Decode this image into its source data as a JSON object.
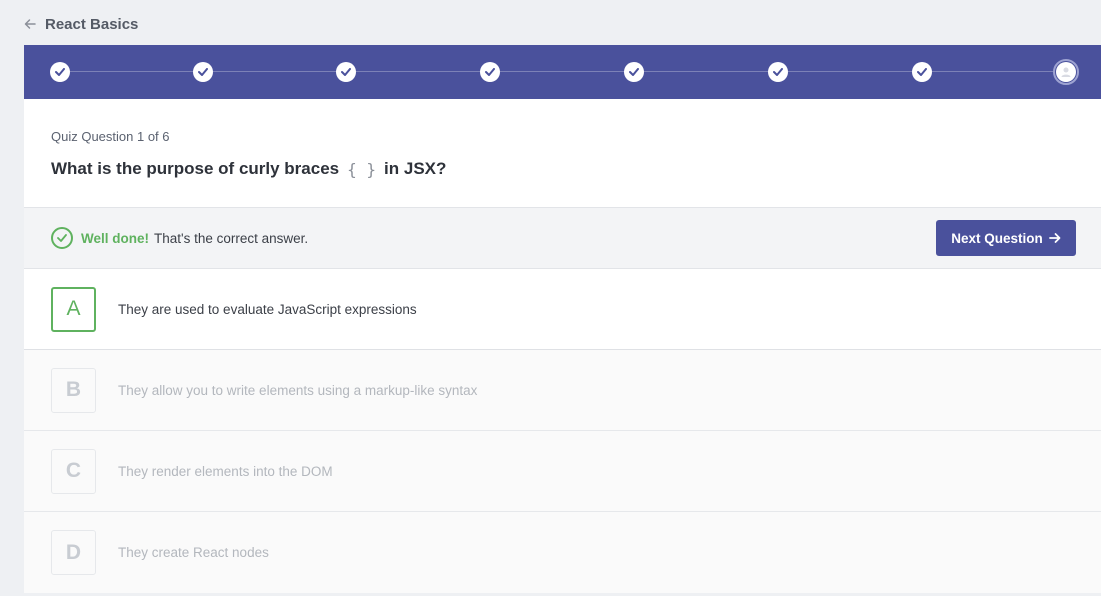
{
  "header": {
    "title": "React Basics",
    "back_icon": "arrow-left-icon"
  },
  "progress": {
    "total_steps": 8,
    "completed_steps": 7,
    "completed_icon": "check-icon",
    "current_icon": "user-icon",
    "colors": {
      "bar": "#4a519c",
      "step": "#ffffff"
    }
  },
  "question": {
    "counter": "Quiz Question 1 of 6",
    "text_before": "What is the purpose of curly braces",
    "code": "{ }",
    "text_after": "in JSX?"
  },
  "feedback": {
    "icon": "check-circle-icon",
    "strong": "Well done!",
    "text": "That's the correct answer.",
    "color": "#5fb25f"
  },
  "next_button": {
    "label": "Next Question",
    "icon": "arrow-right-icon"
  },
  "options": [
    {
      "letter": "A",
      "text": "They are used to evaluate JavaScript expressions",
      "selected": true
    },
    {
      "letter": "B",
      "text": "They allow you to write elements using a markup-like syntax",
      "selected": false
    },
    {
      "letter": "C",
      "text": "They render elements into the DOM",
      "selected": false
    },
    {
      "letter": "D",
      "text": "They create React nodes",
      "selected": false
    }
  ]
}
